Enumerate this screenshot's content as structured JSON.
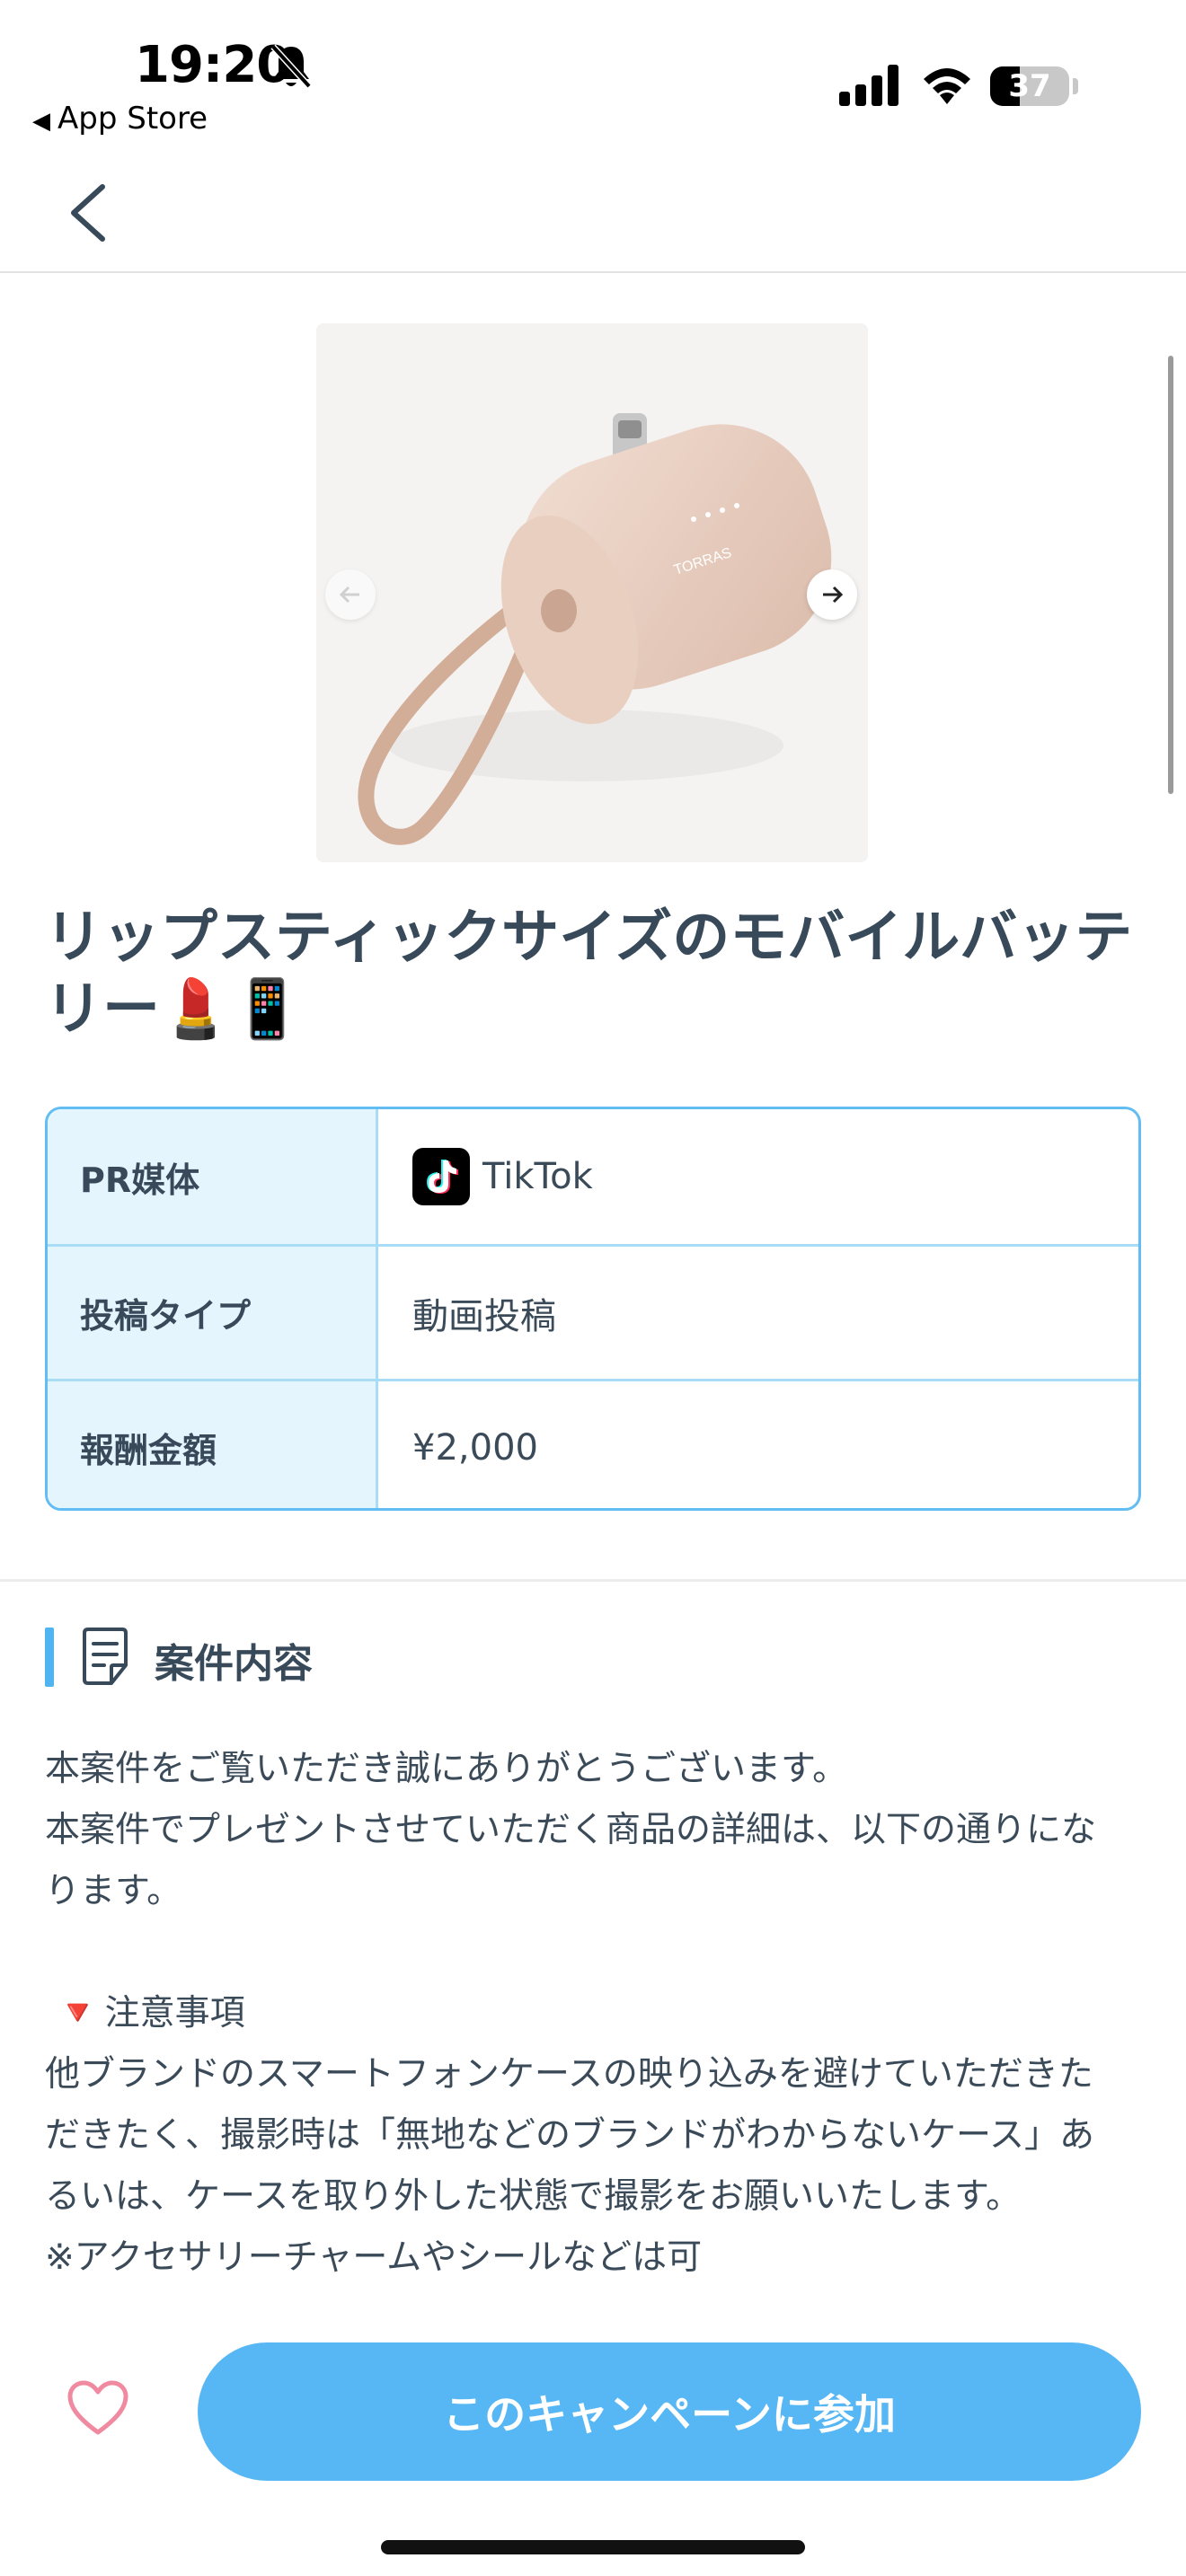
{
  "status_bar": {
    "time": "19:20",
    "back_app_label": "App Store",
    "battery_level": "37"
  },
  "product": {
    "title": "リップスティックサイズのモバイルバッテリー💄📱",
    "image_brand_text": "TORRAS"
  },
  "info_table": {
    "rows": [
      {
        "label": "PR媒体",
        "value": "TikTok",
        "icon": "tiktok-icon"
      },
      {
        "label": "投稿タイプ",
        "value": "動画投稿"
      },
      {
        "label": "報酬金額",
        "value": "¥2,000"
      }
    ]
  },
  "section": {
    "title": "案件内容",
    "icon": "document-icon",
    "lines": [
      "本案件をご覧いただき誠にありがとうございます。",
      "本案件でプレゼントさせていただく商品の詳細は、以下の通りにな",
      "ります。",
      "",
      "注意事項",
      "他ブランドのスマートフォンケースの映り込みを避けていただきた",
      "だきたく、撮影時は「無地などのブランドがわからないケース」あ",
      "るいは、ケースを取り外した状態で撮影をお願いいたします。",
      "※アクセサリーチャームやシールなどは可"
    ],
    "warning_icon": "🔻"
  },
  "bottom": {
    "join_button_label": "このキャンペーンに参加",
    "favorite_icon": "heart-icon"
  },
  "colors": {
    "accent": "#57b7f5",
    "table_border": "#62bdf2",
    "table_label_bg": "#e4f5fe",
    "heart": "#f08aa0",
    "text": "#38495a"
  }
}
